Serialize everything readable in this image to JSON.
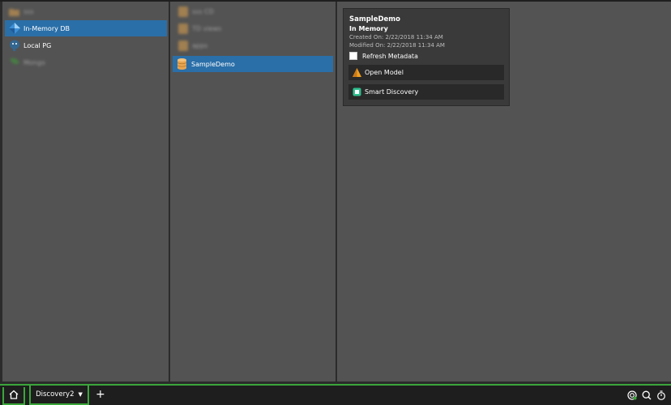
{
  "sources": {
    "items": [
      {
        "label": "sss",
        "blurred": true,
        "icon": "folder-icon"
      },
      {
        "label": "In-Memory DB",
        "selected": true,
        "icon": "cube-icon"
      },
      {
        "label": "Local PG",
        "icon": "postgres-icon"
      },
      {
        "label": "Mongo",
        "blurred": true,
        "icon": "mongo-leaf-icon"
      }
    ]
  },
  "databases": {
    "items": [
      {
        "label": "sss CD",
        "blurred": true,
        "icon": "folder-icon"
      },
      {
        "label": "TD views",
        "blurred": true,
        "icon": "folder-icon"
      },
      {
        "label": "apps",
        "blurred": true,
        "icon": "folder-icon"
      },
      {
        "label": "SampleDemo",
        "selected": true,
        "icon": "database-icon"
      }
    ]
  },
  "details": {
    "title": "SampleDemo",
    "subtitle": "In Memory",
    "created": "Created On: 2/22/2018 11:34 AM",
    "modified": "Modified On: 2/22/2018 11:34 AM",
    "refresh_label": "Refresh Metadata",
    "refresh_checked": false,
    "open_model_label": "Open Model",
    "smart_discovery_label": "Smart Discovery"
  },
  "taskbar": {
    "tab_label": "Discovery2",
    "add_symbol": "+"
  },
  "colors": {
    "selection": "#2a6fa8",
    "accent_green": "#3aa63a",
    "panel_bg": "#535353"
  }
}
